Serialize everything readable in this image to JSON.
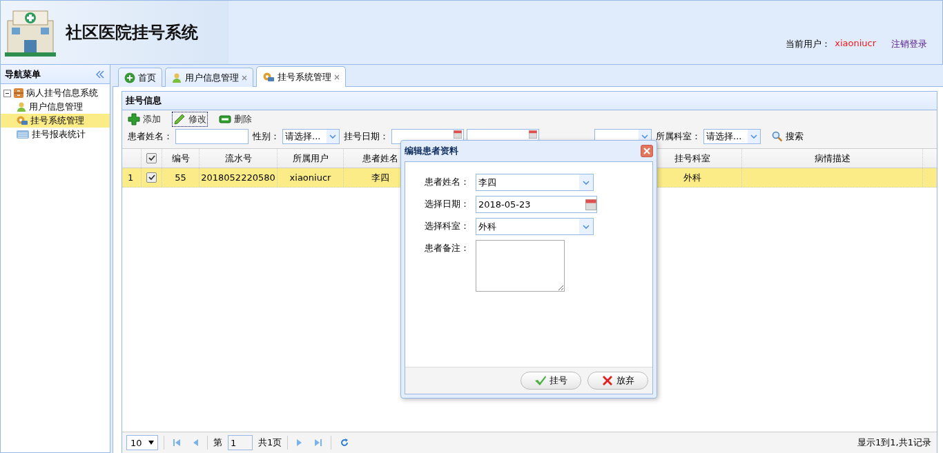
{
  "header": {
    "title": "社区医院挂号系统",
    "user_label": "当前用户：",
    "user_name": "xiaoniucr",
    "logout": "注销登录"
  },
  "nav": {
    "title": "导航菜单",
    "tree": [
      {
        "label": "病人挂号信息系统",
        "expanded": true,
        "children": [
          {
            "label": "用户信息管理",
            "selected": false
          },
          {
            "label": "挂号系统管理",
            "selected": true
          },
          {
            "label": "挂号报表统计",
            "selected": false
          }
        ]
      }
    ]
  },
  "tabs": [
    {
      "label": "首页",
      "closable": false,
      "selected": false
    },
    {
      "label": "用户信息管理",
      "closable": true,
      "selected": false
    },
    {
      "label": "挂号系统管理",
      "closable": true,
      "selected": true
    }
  ],
  "panel": {
    "title": "挂号信息",
    "toolbar": [
      {
        "label": "添加",
        "kind": "add",
        "focused": false
      },
      {
        "label": "修改",
        "kind": "edit",
        "focused": true
      },
      {
        "label": "删除",
        "kind": "delete",
        "focused": false
      }
    ],
    "filters": [
      {
        "label": "患者姓名：",
        "kind": "text"
      },
      {
        "label": "性别：",
        "kind": "select",
        "placeholder": "请选择..."
      },
      {
        "label": "挂号日期：",
        "kind": "date"
      },
      {
        "kind": "date"
      },
      {
        "kind": "select"
      },
      {
        "label": "所属科室：",
        "kind": "select",
        "placeholder": "请选择..."
      }
    ],
    "search": "搜索",
    "grid": {
      "all_checked": true,
      "columns": [
        {
          "label": "编号"
        },
        {
          "label": "流水号"
        },
        {
          "label": "所属用户"
        },
        {
          "label": "患者姓名"
        },
        {
          "label": "挂号科室"
        },
        {
          "label": "病情描述"
        }
      ],
      "rows": [
        {
          "number": "1",
          "checked": true,
          "selected": true,
          "cells": [
            "55",
            "2018052220580",
            "xiaoniucr",
            "李四",
            "外科"
          ]
        }
      ]
    },
    "pager": {
      "page_size": "10",
      "page_prefix": "第",
      "page": "1",
      "page_total": "共1页",
      "info": "显示1到1,共1记录"
    }
  },
  "dialog": {
    "title": "编辑患者资料",
    "fields": [
      {
        "label": "患者姓名：",
        "kind": "select",
        "value": "李四"
      },
      {
        "label": "选择日期：",
        "kind": "date",
        "value": "2018-05-23"
      },
      {
        "label": "选择科室：",
        "kind": "select",
        "value": "外科"
      },
      {
        "label": "患者备注：",
        "kind": "textarea"
      }
    ],
    "buttons": [
      {
        "label": "挂号",
        "kind": "ok"
      },
      {
        "label": "放弃",
        "kind": "cancel"
      }
    ]
  }
}
